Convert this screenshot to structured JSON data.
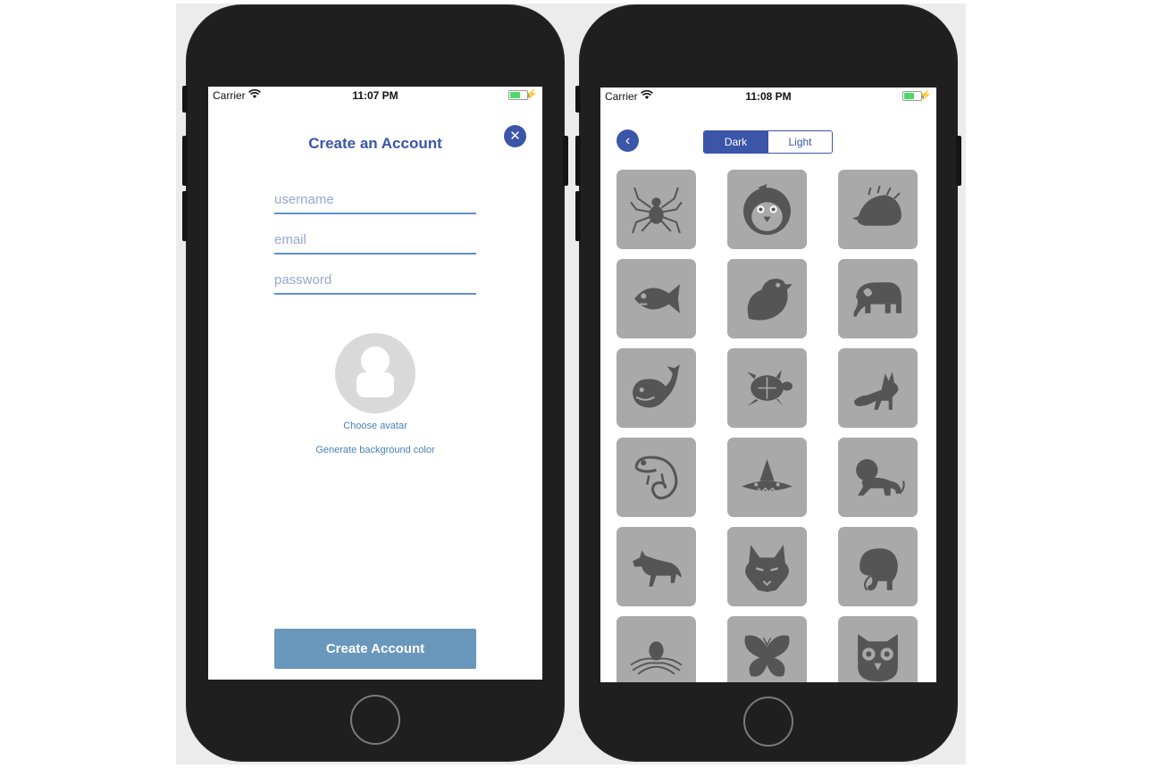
{
  "left_screen": {
    "status_bar": {
      "carrier": "Carrier",
      "time": "11:07 PM",
      "battery_level": 0.6
    },
    "title": "Create an Account",
    "fields": {
      "username_placeholder": "username",
      "email_placeholder": "email",
      "password_placeholder": "password"
    },
    "avatar_icon": "person-icon",
    "choose_avatar_label": "Choose avatar",
    "generate_color_label": "Generate background color",
    "create_button_label": "Create Account",
    "close_icon": "close-icon"
  },
  "right_screen": {
    "status_bar": {
      "carrier": "Carrier",
      "time": "11:08 PM",
      "battery_level": 0.6
    },
    "back_icon": "chevron-left-icon",
    "theme_toggle": {
      "options": [
        "Dark",
        "Light"
      ],
      "selected": "Dark"
    },
    "avatars": [
      "spider",
      "penguin",
      "hedgehog",
      "fish",
      "bird",
      "elephant",
      "whale",
      "turtle",
      "fox",
      "chameleon",
      "shark",
      "lion",
      "wolf",
      "wolf-head",
      "mammoth",
      "octopus",
      "butterfly",
      "owl"
    ]
  },
  "colors": {
    "accent": "#3b55a8",
    "button": "#6a97bc",
    "link": "#4a7fb5",
    "tile_bg": "#a9a9a9",
    "icon_dark": "#555555"
  }
}
